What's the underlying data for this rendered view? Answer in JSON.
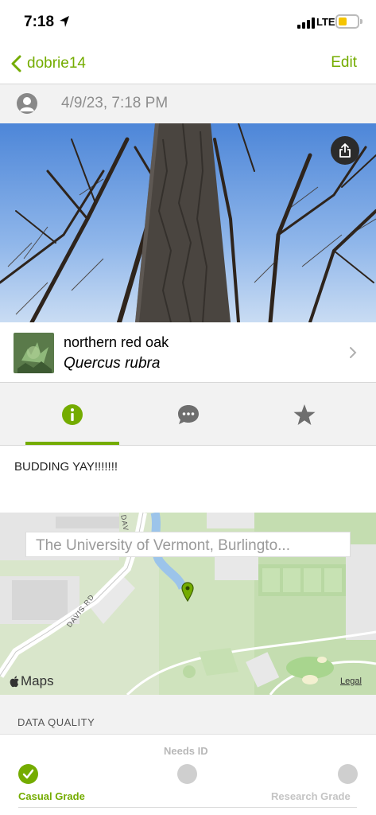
{
  "status_bar": {
    "time": "7:18",
    "network": "LTE"
  },
  "nav": {
    "back_label": "dobrie14",
    "edit_label": "Edit"
  },
  "observation": {
    "date": "4/9/23, 7:18 PM"
  },
  "taxon": {
    "common_name": "northern red oak",
    "scientific_name": "Quercus rubra"
  },
  "tabs": [
    {
      "name": "info",
      "icon": "info-icon",
      "active": true
    },
    {
      "name": "comments",
      "icon": "speech-bubble-icon",
      "active": false
    },
    {
      "name": "favorites",
      "icon": "star-icon",
      "active": false
    }
  ],
  "description": "BUDDING YAY!!!!!!!",
  "map": {
    "search_text": "The University of Vermont, Burlingto...",
    "road_label_1": "DAVIS RD",
    "road_label_2": "DAV",
    "maps_label": "Maps",
    "legal_label": "Legal"
  },
  "data_quality": {
    "title": "DATA QUALITY",
    "needs_id_label": "Needs ID",
    "casual_label": "Casual Grade",
    "research_label": "Research Grade",
    "current": "casual"
  },
  "colors": {
    "accent": "#74ac00",
    "inactive": "#c4c4c4"
  }
}
